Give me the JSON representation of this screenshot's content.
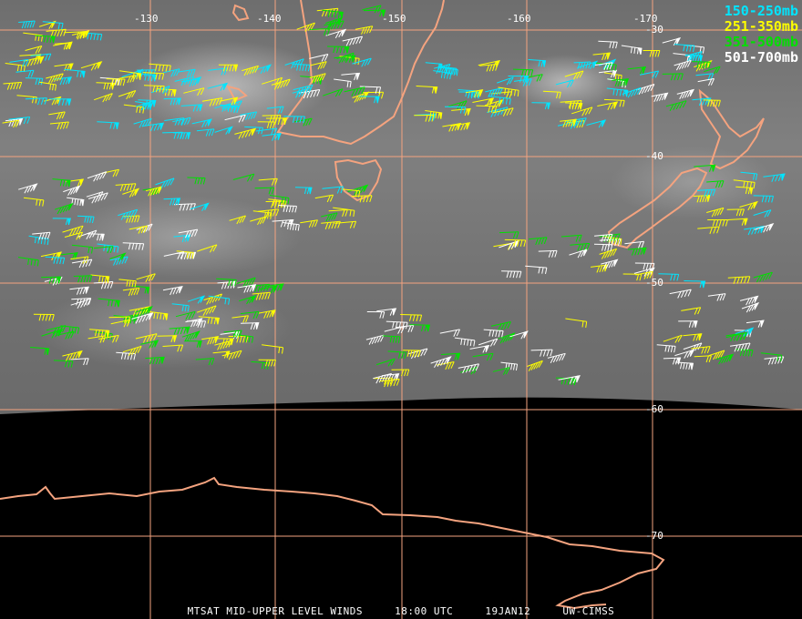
{
  "map": {
    "lon_labels": [
      "-130",
      "-140",
      "-150",
      "-160",
      "-170"
    ],
    "lat_labels": [
      "-30",
      "-40",
      "-50",
      "-60",
      "-70"
    ],
    "coastline_color": "#f4a37f",
    "grid_color": "#f4a37f",
    "background_color": "#777777",
    "earth_limb_color": "#000000"
  },
  "legend": [
    {
      "label": "150-250mb",
      "color": "#00e5ff"
    },
    {
      "label": "251-350mb",
      "color": "#ffff00"
    },
    {
      "label": "351-500mb",
      "color": "#00e000"
    },
    {
      "label": "501-700mb",
      "color": "#ffffff"
    }
  ],
  "footer": {
    "product": "MTSAT MID-UPPER LEVEL WINDS",
    "time": "18:00 UTC",
    "date": "19JAN12",
    "source": "UW-CIMSS"
  }
}
